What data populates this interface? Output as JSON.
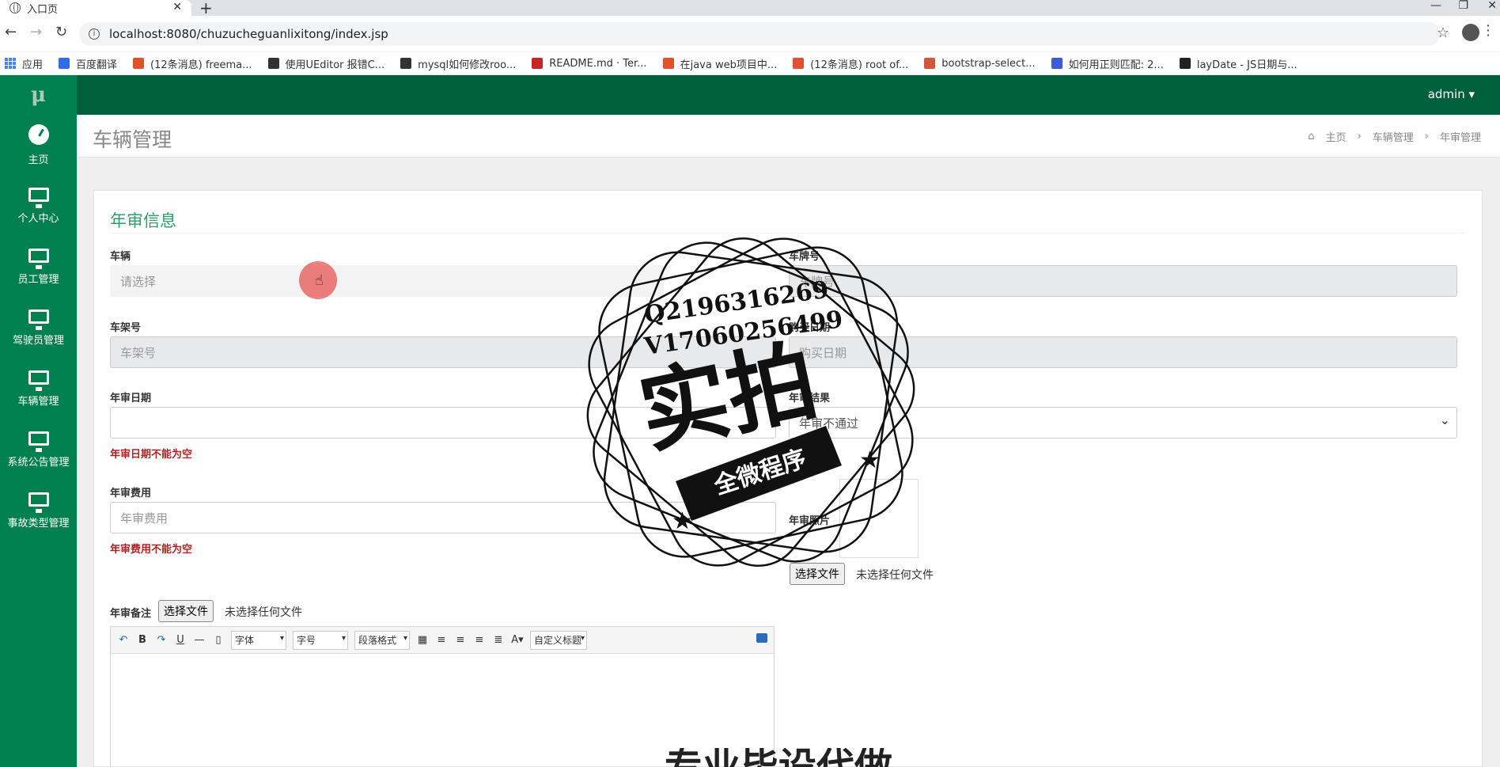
{
  "browser": {
    "tab_title": "入口页",
    "url": "localhost:8080/chuzucheguanlixitong/index.jsp",
    "bookmarks": [
      {
        "label": "应用",
        "color": "#4285f4"
      },
      {
        "label": "百度翻译",
        "color": "#2c6ee8"
      },
      {
        "label": "(12条消息) freema...",
        "color": "#e2512e"
      },
      {
        "label": "使用UEditor 报错C...",
        "color": "#333333"
      },
      {
        "label": "mysql如何修改roo...",
        "color": "#333333"
      },
      {
        "label": "README.md · Ter...",
        "color": "#c7242a"
      },
      {
        "label": "在java web项目中...",
        "color": "#e2512e"
      },
      {
        "label": "(12条消息) root of...",
        "color": "#e2512e"
      },
      {
        "label": "bootstrap-select...",
        "color": "#d4553b"
      },
      {
        "label": "如何用正则匹配: 2...",
        "color": "#3b5bdb"
      },
      {
        "label": "layDate - JS日期与...",
        "color": "#222222"
      }
    ]
  },
  "app": {
    "logo": "μ",
    "user_menu": "admin ▾",
    "sidebar": [
      {
        "label": "主页",
        "icon": "dashboard-icon"
      },
      {
        "label": "个人中心",
        "icon": "monitor-icon"
      },
      {
        "label": "员工管理",
        "icon": "monitor-icon"
      },
      {
        "label": "驾驶员管理",
        "icon": "monitor-icon"
      },
      {
        "label": "车辆管理",
        "icon": "monitor-icon"
      },
      {
        "label": "系统公告管理",
        "icon": "monitor-icon"
      },
      {
        "label": "事故类型管理",
        "icon": "monitor-icon"
      }
    ],
    "page_title": "车辆管理",
    "breadcrumb": [
      "主页",
      "车辆管理",
      "年审管理"
    ]
  },
  "form": {
    "section_title": "年审信息",
    "vehicle_label": "车辆",
    "vehicle_placeholder": "请选择",
    "plate_label": "车牌号",
    "plate_placeholder": "车牌号",
    "frame_label": "车架号",
    "frame_placeholder": "车架号",
    "purchase_label": "购买日期",
    "purchase_placeholder": "购买日期",
    "review_date_label": "年审日期",
    "review_date_error": "年审日期不能为空",
    "result_label": "年审结果",
    "result_value": "年审不通过",
    "fee_label": "年审费用",
    "fee_placeholder": "年审费用",
    "fee_error": "年审费用不能为空",
    "photo_label": "年审照片",
    "file_button": "选择文件",
    "file_none": "未选择任何文件",
    "remark_label": "年审备注",
    "editor": {
      "font_family": "字体",
      "font_size": "字号",
      "paragraph": "段落格式",
      "custom_title": "自定义标题"
    }
  },
  "watermark": {
    "line1": "Q2196316269",
    "line2": "V17060256499",
    "big": "实拍",
    "ribbon": "全微程序",
    "bottom": "专业毕设代做"
  }
}
